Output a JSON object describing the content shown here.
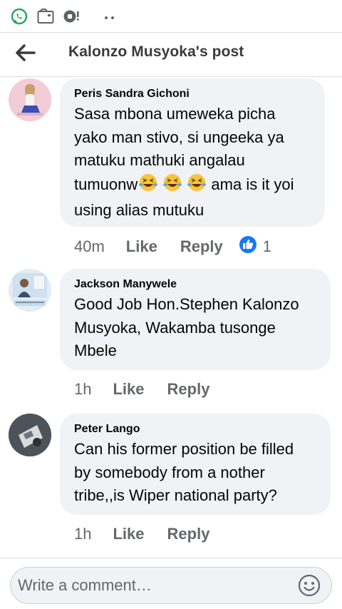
{
  "header": {
    "title": "Kalonzo Musyoka's post"
  },
  "comments": [
    {
      "author": "Peris Sandra Gichoni",
      "text_lines": [
        "Sasa mbona umeweka picha",
        "yako man stivo, si ungeeka ya",
        "matuku mathuki angalau",
        "tumuonw",
        "ama is it yoi",
        "using alias mutuku"
      ],
      "time": "40m",
      "like": "Like",
      "reply": "Reply",
      "reaction_count": "1"
    },
    {
      "author": "Jackson Manywele",
      "text_lines": [
        "Good Job Hon.Stephen Kalonzo",
        "Musyoka, Wakamba tusonge",
        "Mbele"
      ],
      "time": "1h",
      "like": "Like",
      "reply": "Reply"
    },
    {
      "author": "Peter Lango",
      "text_lines": [
        "Can his former position be filled",
        "by somebody from a nother",
        "tribe,,is Wiper national party?"
      ],
      "time": "1h",
      "like": "Like",
      "reply": "Reply"
    }
  ],
  "composer": {
    "placeholder": "Write a comment…"
  },
  "icons": [
    "whatsapp-icon",
    "media-icon",
    "notification-icon",
    "more-icon",
    "back-arrow-icon",
    "laughing-emoji-icon",
    "like-reaction-icon",
    "smiley-icon"
  ],
  "colors": {
    "bubble": "#f0f2f5",
    "meta": "#65676b",
    "like_blue": "#1877f2",
    "emoji_yellow": "#f7c33e"
  }
}
